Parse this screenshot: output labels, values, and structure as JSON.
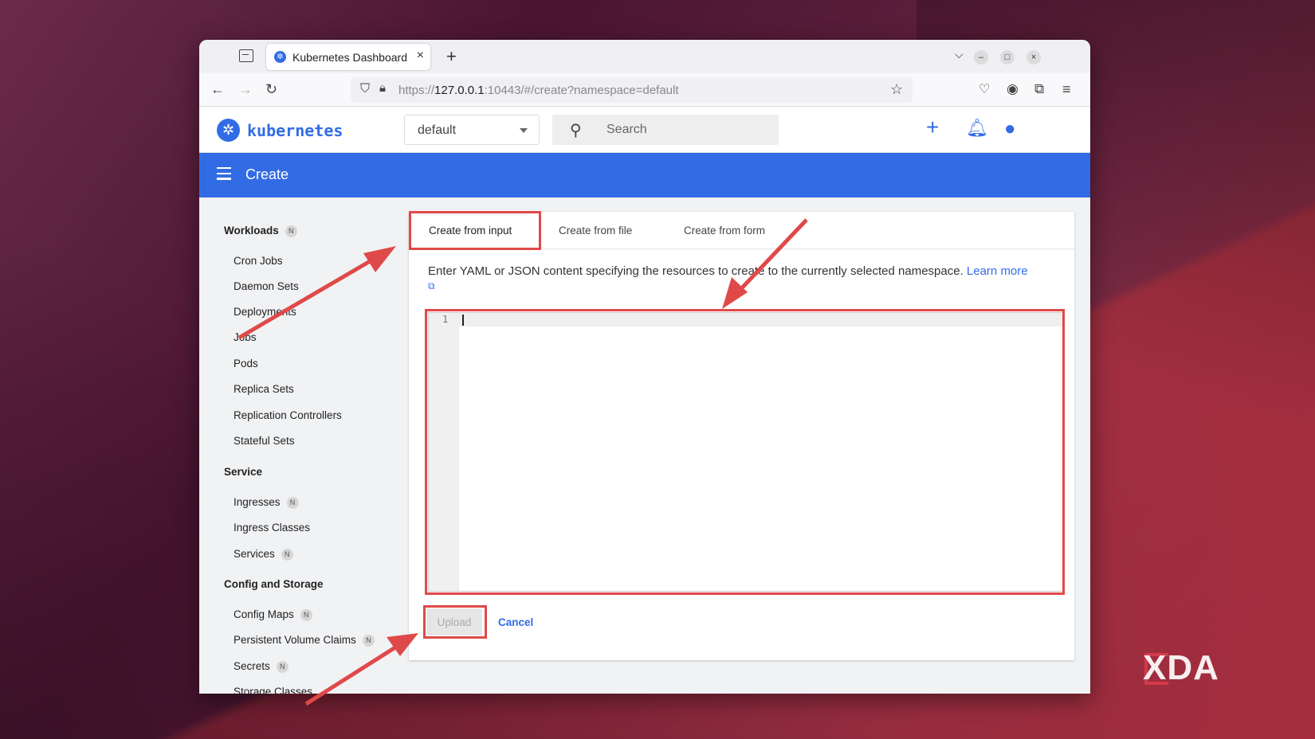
{
  "browser": {
    "tab_title": "Kubernetes Dashboard",
    "url_prefix": "https://",
    "url_host": "127.0.0.1",
    "url_rest": ":10443/#/create?namespace=default"
  },
  "header": {
    "brand": "kubernetes",
    "namespace": "default",
    "search_placeholder": "Search"
  },
  "toolbar": {
    "title": "Create"
  },
  "sidebar": {
    "sections": [
      {
        "title": "Workloads",
        "badge": "N",
        "items": [
          {
            "label": "Cron Jobs"
          },
          {
            "label": "Daemon Sets"
          },
          {
            "label": "Deployments"
          },
          {
            "label": "Jobs"
          },
          {
            "label": "Pods"
          },
          {
            "label": "Replica Sets"
          },
          {
            "label": "Replication Controllers"
          },
          {
            "label": "Stateful Sets"
          }
        ]
      },
      {
        "title": "Service",
        "items": [
          {
            "label": "Ingresses",
            "badge": "N"
          },
          {
            "label": "Ingress Classes"
          },
          {
            "label": "Services",
            "badge": "N"
          }
        ]
      },
      {
        "title": "Config and Storage",
        "items": [
          {
            "label": "Config Maps",
            "badge": "N"
          },
          {
            "label": "Persistent Volume Claims",
            "badge": "N"
          },
          {
            "label": "Secrets",
            "badge": "N"
          },
          {
            "label": "Storage Classes"
          }
        ]
      }
    ]
  },
  "create": {
    "tabs": [
      {
        "label": "Create from input"
      },
      {
        "label": "Create from file"
      },
      {
        "label": "Create from form"
      }
    ],
    "description": "Enter YAML or JSON content specifying the resources to create to the currently selected namespace.",
    "learn_more": "Learn more",
    "editor_line": "1",
    "upload_label": "Upload",
    "cancel_label": "Cancel"
  },
  "watermark": "XDA",
  "colors": {
    "accent": "#326ce5",
    "annotation": "#e04949"
  }
}
